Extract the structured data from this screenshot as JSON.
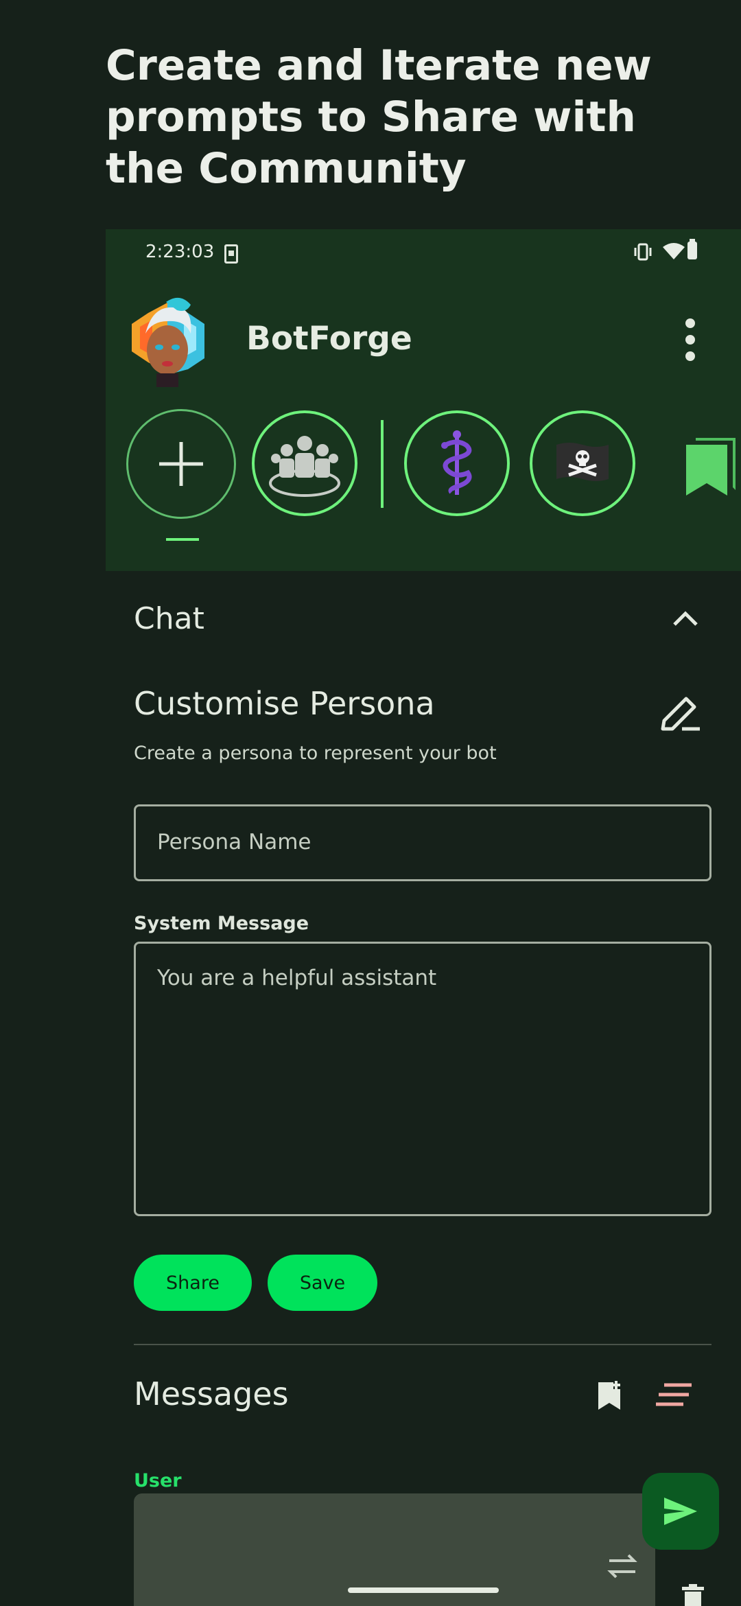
{
  "headline": "Create and Iterate new prompts to Share with the Community",
  "status": {
    "time": "2:23:03"
  },
  "app": {
    "name": "BotForge"
  },
  "personas": [
    {
      "icon": "plus-icon"
    },
    {
      "icon": "community-icon"
    },
    {
      "icon": "caduceus-icon"
    },
    {
      "icon": "pirate-flag-icon"
    },
    {
      "icon": "bookmarks-icon"
    }
  ],
  "chat": {
    "title": "Chat"
  },
  "persona": {
    "title": "Customise Persona",
    "subtitle": "Create a persona to represent your bot",
    "name_placeholder": "Persona Name",
    "system_label": "System Message",
    "system_value": "You are a helpful assistant",
    "share_label": "Share",
    "save_label": "Save"
  },
  "messages": {
    "title": "Messages",
    "role_label": "User"
  },
  "colors": {
    "accent": "#6ef27c",
    "button": "#00e25b",
    "user": "#27e06a",
    "header_bg": "#18341e"
  }
}
